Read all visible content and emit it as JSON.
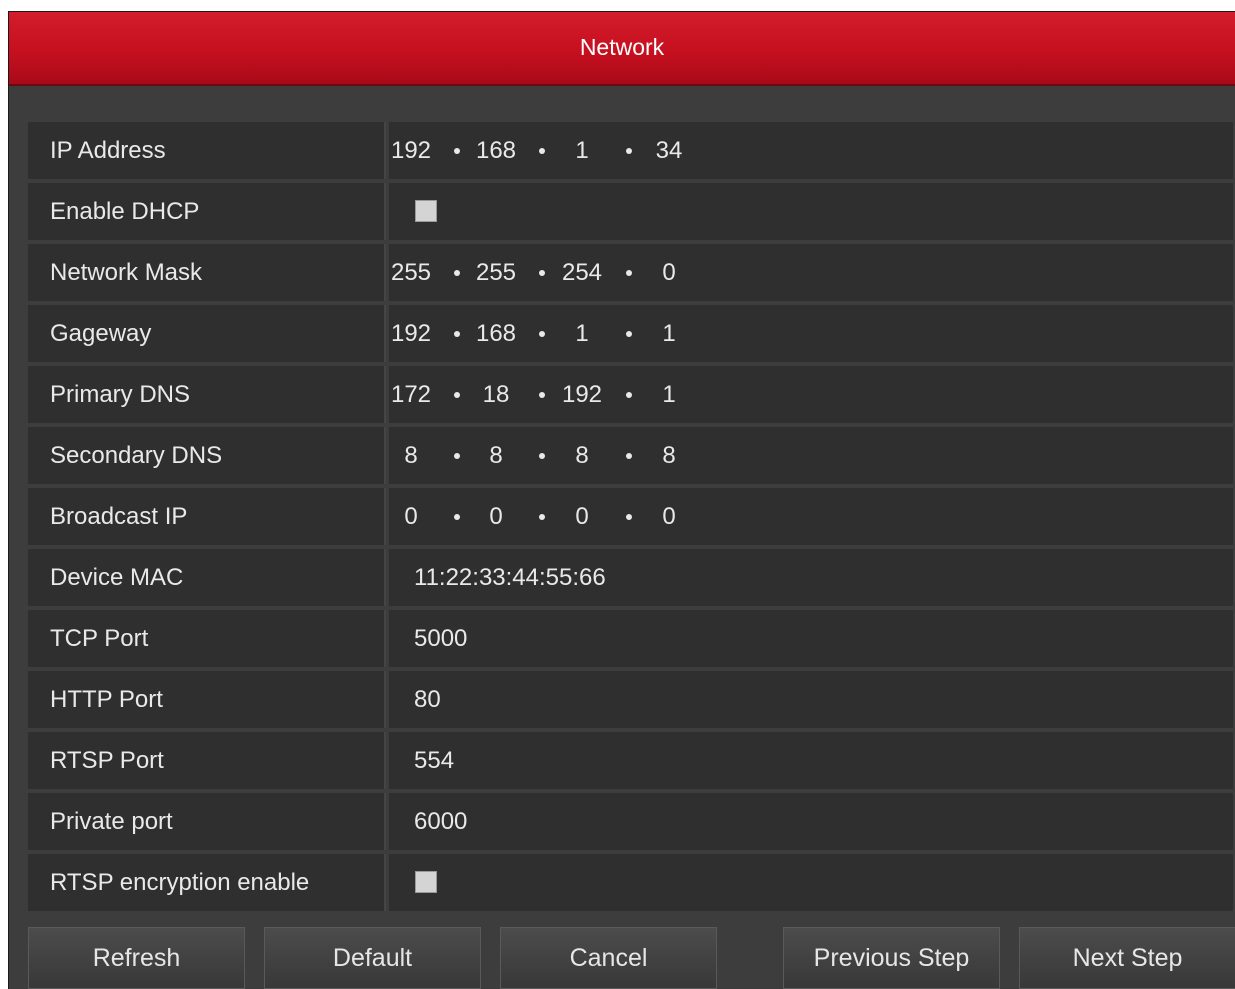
{
  "window": {
    "title": "Network"
  },
  "fields": [
    {
      "label": "IP Address",
      "type": "ip",
      "octets": [
        "192",
        "168",
        "1",
        "34"
      ]
    },
    {
      "label": "Enable DHCP",
      "type": "checkbox",
      "checked": false
    },
    {
      "label": "Network Mask",
      "type": "ip",
      "octets": [
        "255",
        "255",
        "254",
        "0"
      ]
    },
    {
      "label": "Gageway",
      "type": "ip",
      "octets": [
        "192",
        "168",
        "1",
        "1"
      ]
    },
    {
      "label": "Primary DNS",
      "type": "ip",
      "octets": [
        "172",
        "18",
        "192",
        "1"
      ]
    },
    {
      "label": "Secondary DNS",
      "type": "ip",
      "octets": [
        "8",
        "8",
        "8",
        "8"
      ]
    },
    {
      "label": "Broadcast IP",
      "type": "ip",
      "octets": [
        "0",
        "0",
        "0",
        "0"
      ]
    },
    {
      "label": "Device MAC",
      "type": "text",
      "value": "11:22:33:44:55:66"
    },
    {
      "label": "TCP Port",
      "type": "text",
      "value": "5000"
    },
    {
      "label": "HTTP Port",
      "type": "text",
      "value": "80"
    },
    {
      "label": "RTSP Port",
      "type": "text",
      "value": "554"
    },
    {
      "label": "Private port",
      "type": "text",
      "value": "6000"
    },
    {
      "label": "RTSP encryption enable",
      "type": "checkbox",
      "checked": false
    }
  ],
  "buttons": {
    "refresh": "Refresh",
    "default": "Default",
    "cancel": "Cancel",
    "previous_step": "Previous Step",
    "next_step": "Next Step"
  },
  "colors": {
    "title_bar": "#c6101f",
    "panel_bg": "#3d3d3d",
    "cell_bg": "#2f2f2f",
    "text": "#e9e9e9"
  }
}
